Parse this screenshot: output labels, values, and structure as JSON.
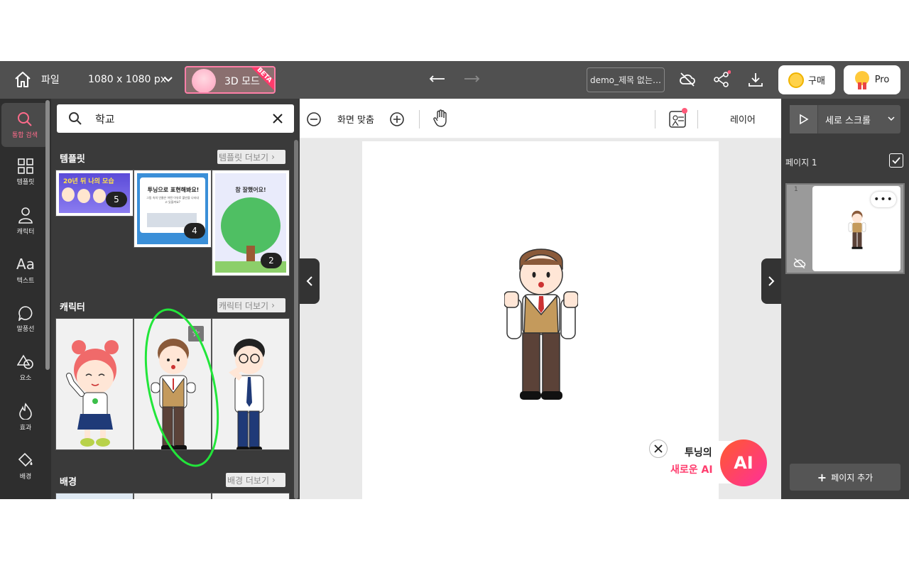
{
  "topbar": {
    "file_label": "파일",
    "size_label": "1080 x 1080 px",
    "mode_label": "3D 모드",
    "beta_label": "BETA",
    "doc_title": "demo_제목 없는…",
    "buy_label": "구매",
    "pro_label": "Pro"
  },
  "nav": {
    "items": [
      {
        "label": "통합 검색",
        "icon": "search-icon"
      },
      {
        "label": "템플릿",
        "icon": "grid-icon"
      },
      {
        "label": "캐릭터",
        "icon": "person-icon"
      },
      {
        "label": "텍스트",
        "icon": "text-icon"
      },
      {
        "label": "말풍선",
        "icon": "speech-bubble-icon"
      },
      {
        "label": "요소",
        "icon": "shapes-icon"
      },
      {
        "label": "효과",
        "icon": "flame-icon"
      },
      {
        "label": "배경",
        "icon": "paint-bucket-icon"
      }
    ]
  },
  "search": {
    "value": "학교"
  },
  "sections": {
    "templates": {
      "title": "템플릿",
      "more": "템플릿 더보기"
    },
    "characters": {
      "title": "캐릭터",
      "more": "캐릭터 더보기"
    },
    "backgrounds": {
      "title": "배경",
      "more": "배경 더보기"
    }
  },
  "templates": [
    {
      "badge": "5",
      "text": "20년 뒤 나의 모습"
    },
    {
      "badge": "4",
      "text": "투닝으로 표현해봐요!",
      "sub": "그림 속의 인물은 어떤 이유로 불만을 나타내고 있을까요?"
    },
    {
      "badge": "2",
      "text": "참 잘했어요!"
    }
  ],
  "toolbar2": {
    "fit_label": "화면 맞춤",
    "layer_label": "레이어"
  },
  "ai_promo": {
    "line1": "투닝의",
    "line2": "새로운 AI",
    "badge": "AI"
  },
  "right": {
    "scroll_mode": "세로 스크롤",
    "page_label": "페이지 1",
    "page_number": "1",
    "add_page": "페이지 추가"
  },
  "colors": {
    "accent_pink": "#ff6b8b",
    "highlight_green": "#22e63a",
    "ai_gradient_start": "#ff3d7f",
    "ai_gradient_end": "#ff5a2d"
  }
}
